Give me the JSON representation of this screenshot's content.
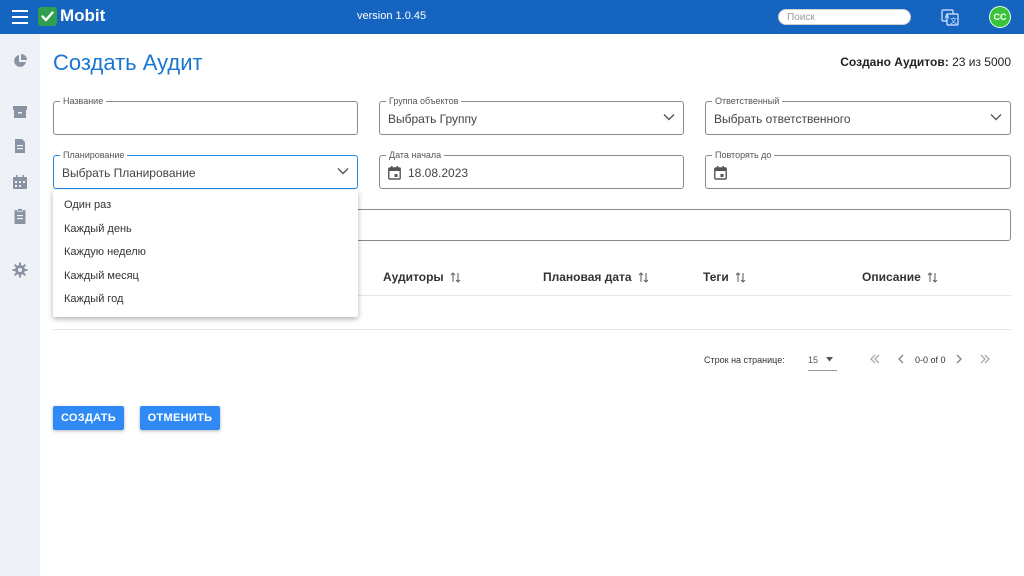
{
  "header": {
    "brand": "Mobit",
    "version": "version 1.0.45",
    "search_placeholder": "Поиск",
    "avatar_initials": "CC"
  },
  "page": {
    "title": "Создать Аудит",
    "count_label": "Создано Аудитов:",
    "count_value": "23 из 5000"
  },
  "form": {
    "name": {
      "label": "Название",
      "value": ""
    },
    "group": {
      "label": "Группа объектов",
      "value": "Выбрать Группу"
    },
    "responsible": {
      "label": "Ответственный",
      "value": "Выбрать ответственного"
    },
    "planning": {
      "label": "Планирование",
      "value": "Выбрать Планирование"
    },
    "start_date": {
      "label": "Дата начала",
      "value": "18.08.2023"
    },
    "repeat_until": {
      "label": "Повторять до",
      "value": ""
    },
    "description": {
      "value": ""
    }
  },
  "planning_options": [
    "Один раз",
    "Каждый день",
    "Каждую неделю",
    "Каждый месяц",
    "Каждый год"
  ],
  "table": {
    "columns": [
      "Аудиторы",
      "Плановая дата",
      "Теги",
      "Описание"
    ]
  },
  "pagination": {
    "rows_label": "Строк на странице:",
    "rows_value": "15",
    "range": "0-0 of 0"
  },
  "buttons": {
    "create": "СОЗДАТЬ",
    "cancel": "ОТМЕНИТЬ"
  },
  "colors": {
    "header_bg": "#1565c0",
    "accent": "#1976d2",
    "button": "#2f8af5",
    "avatar": "#3bc43b"
  }
}
